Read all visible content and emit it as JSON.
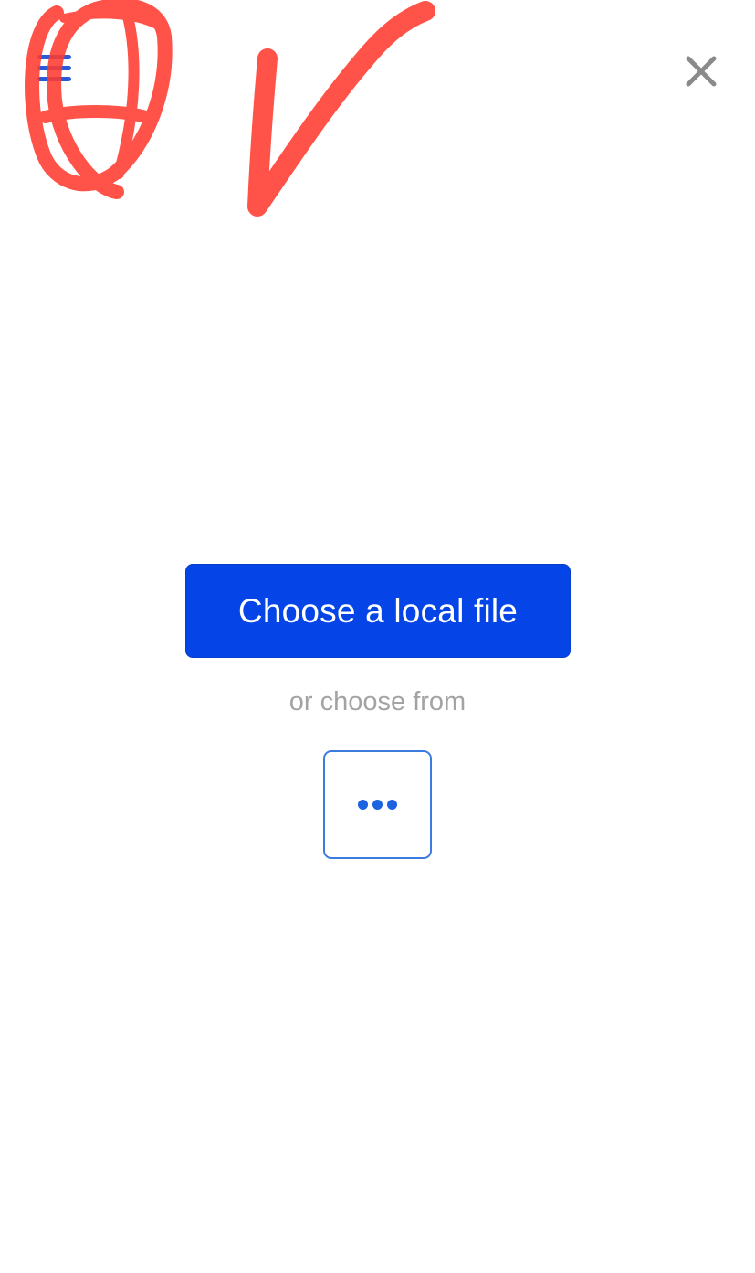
{
  "header": {
    "menu_icon": "hamburger-menu-icon",
    "close_icon": "close-icon"
  },
  "annotation": {
    "color": "#ff3b30",
    "description_icon": "red-handwritten-scribble"
  },
  "main": {
    "primary_button_label": "Choose a local file",
    "alternate_text": "or choose from",
    "more_icon": "more-options-icon"
  },
  "colors": {
    "primary": "#0544e6",
    "menu_bar": "#2a5ad8",
    "close_icon": "#8a8a8a",
    "muted_text": "#a3a3a3",
    "more_border": "#3c7be0"
  }
}
